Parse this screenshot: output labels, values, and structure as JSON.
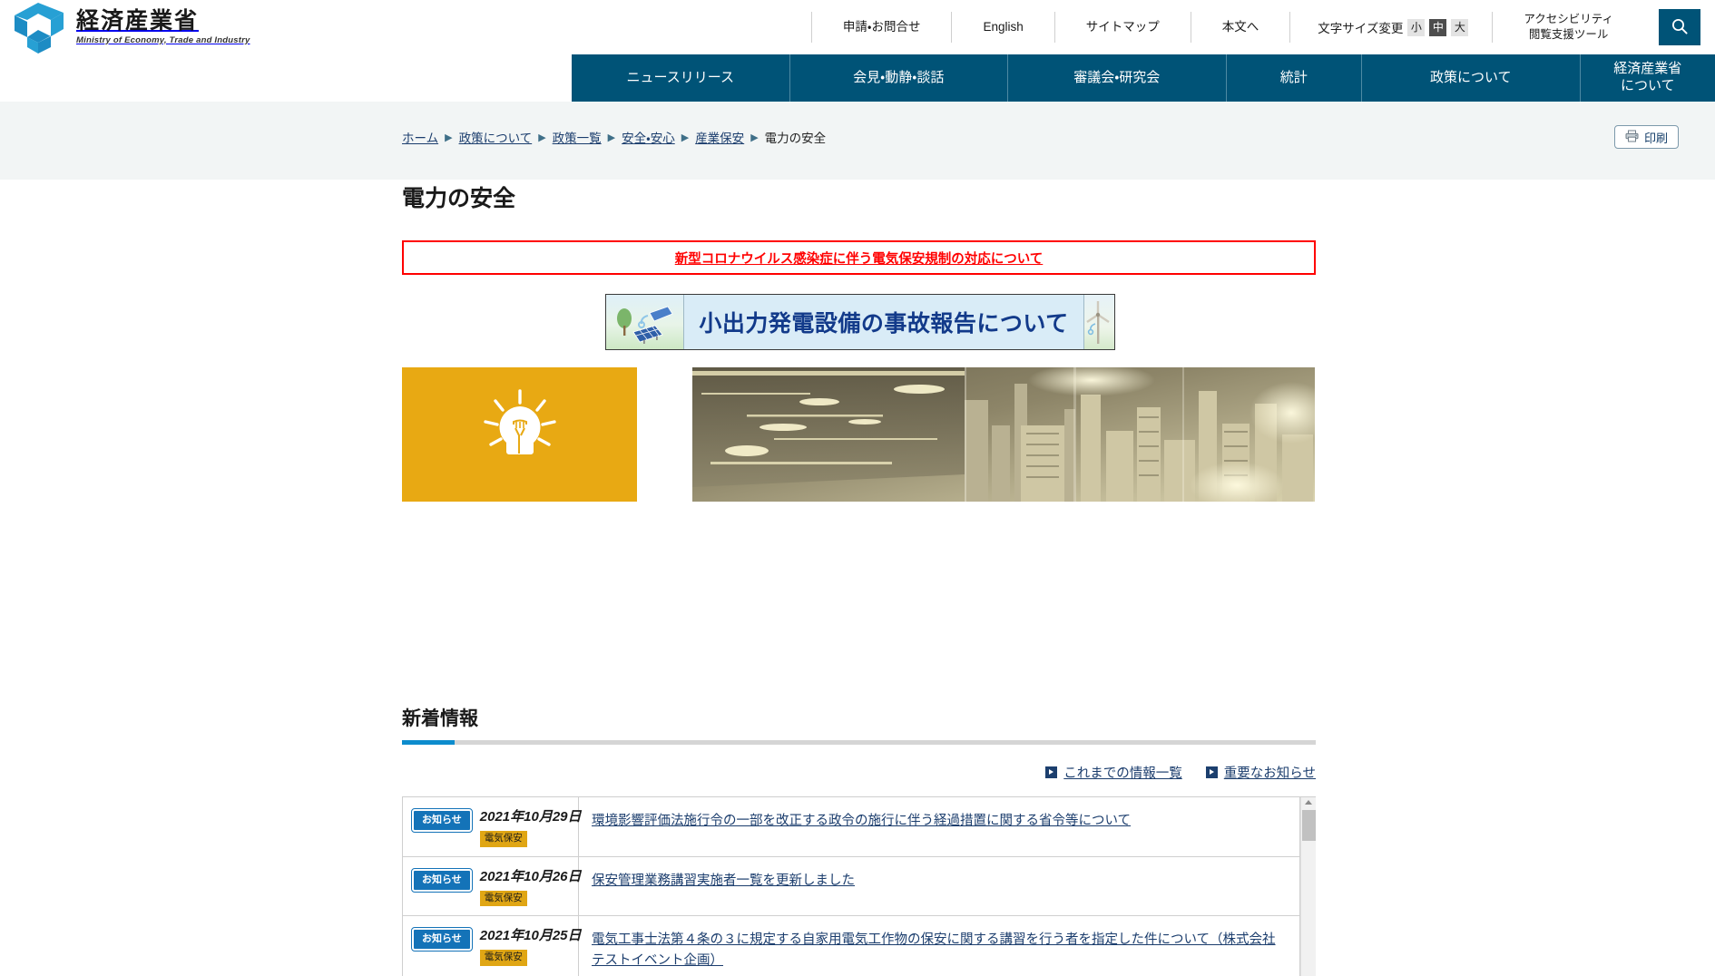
{
  "site": {
    "logo_jp": "経済産業省",
    "logo_en": "Ministry of Economy, Trade and Industry",
    "logo_icon": "meti-logo-icon"
  },
  "utility": {
    "links": [
      {
        "label": "申請・お問合せ"
      },
      {
        "label": "English"
      },
      {
        "label": "サイトマップ"
      },
      {
        "label": "本文へ"
      }
    ],
    "font_size": {
      "label": "文字サイズ変更",
      "options": [
        {
          "label": "小",
          "active": false
        },
        {
          "label": "中",
          "active": true
        },
        {
          "label": "大",
          "active": false
        }
      ]
    },
    "accessibility": {
      "line1": "アクセシビリティ",
      "line2": "閲覧支援ツール"
    },
    "search_icon": "search-icon"
  },
  "global_nav": [
    {
      "label": "ニュースリリース"
    },
    {
      "label": "会見・動静・談話"
    },
    {
      "label": "審議会・研究会"
    },
    {
      "label": "統計"
    },
    {
      "label": "政策について"
    },
    {
      "label": "経済産業省\nについて"
    }
  ],
  "breadcrumb": {
    "separator": "▶",
    "items": [
      {
        "label": "ホーム",
        "link": true
      },
      {
        "label": "政策について",
        "link": true
      },
      {
        "label": "政策一覧",
        "link": true
      },
      {
        "label": "安全・安心",
        "link": true
      },
      {
        "label": "産業保安",
        "link": true
      },
      {
        "label": "電力の安全",
        "link": false
      }
    ]
  },
  "print_button": {
    "label": "印刷",
    "icon": "printer-icon"
  },
  "page": {
    "title": "電力の安全"
  },
  "alert": {
    "text": "新型コロナウイルス感染症に伴う電気保安規制の対応について",
    "border_color": "#ff0000",
    "text_color": "#ff0000"
  },
  "banner": {
    "text": "小出力発電設備の事故報告について",
    "text_color": "#123a8a",
    "background": "#d9ecf7",
    "left_icon": "solar-panel-icon",
    "right_icon": "wind-turbine-icon"
  },
  "promos": [
    {
      "name": "lightbulb-banner",
      "icon": "lightbulb-icon",
      "background": "#e8a913"
    },
    {
      "name": "cityscape-banner",
      "icon": "night-cityscape-image"
    }
  ],
  "news_section": {
    "heading": "新着情報",
    "accent_color": "#0d8ccd",
    "sub_links": [
      {
        "label": "これまでの情報一覧",
        "icon": "triangle-right-icon"
      },
      {
        "label": "重要なお知らせ",
        "icon": "triangle-right-icon"
      }
    ],
    "items": [
      {
        "badge": "お知らせ",
        "date": "2021年10月29日",
        "tag": "電気保安",
        "title": "環境影響評価法施行令の一部を改正する政令の施行に伴う経過措置に関する省令等について"
      },
      {
        "badge": "お知らせ",
        "date": "2021年10月26日",
        "tag": "電気保安",
        "title": "保安管理業務講習実施者一覧を更新しました"
      },
      {
        "badge": "お知らせ",
        "date": "2021年10月25日",
        "tag": "電気保安",
        "title": "電気工事士法第４条の３に規定する自家用電気工作物の保安に関する講習を行う者を指定した件について（株式会社テストイベント企画）"
      }
    ]
  },
  "colors": {
    "nav_blue": "#005377",
    "accent_blue": "#0d8ccd",
    "link_blue": "#1b3d6d",
    "badge_blue": "#1473b8",
    "tag_gold": "#e0a614",
    "promo_gold": "#e8a913",
    "crumb_band": "#f2f5f5"
  }
}
